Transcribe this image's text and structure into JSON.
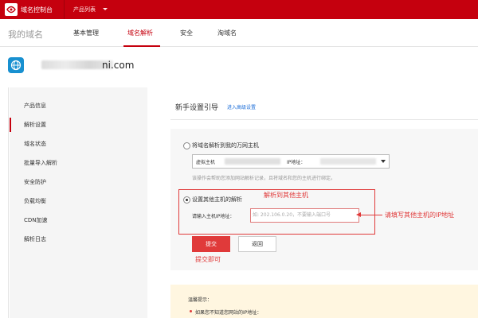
{
  "topbar": {
    "brand": "域名控制台",
    "product_list": "产品列表"
  },
  "nav": {
    "title": "我的域名",
    "tabs": [
      {
        "label": "基本管理",
        "active": false
      },
      {
        "label": "域名解析",
        "active": true
      },
      {
        "label": "安全",
        "active": false
      },
      {
        "label": "淘域名",
        "active": false
      }
    ]
  },
  "domain": {
    "name_visible_part": "ni.com"
  },
  "sidebar": {
    "items": [
      {
        "label": "产品信息",
        "active": false
      },
      {
        "label": "解析设置",
        "active": true
      },
      {
        "label": "域名状态",
        "active": false
      },
      {
        "label": "批量导入解析",
        "active": false
      },
      {
        "label": "安全防护",
        "active": false
      },
      {
        "label": "负载均衡",
        "active": false
      },
      {
        "label": "CDN加速",
        "active": false
      },
      {
        "label": "解析日志",
        "active": false
      }
    ]
  },
  "main": {
    "section_title": "新手设置引导",
    "advanced_link": "进入高级设置",
    "option1": {
      "label": "将域名解析到我的万网主机",
      "selected": false,
      "select_text_prefix": "虚拟主机",
      "select_text_ip": "IP地址：",
      "help_text": "该操作会帮助您添加网站解析记录，且将域名和您的主机进行绑定。"
    },
    "option2": {
      "label": "设置其他主机的解析",
      "selected": true,
      "ip_label": "请输入主机IP地址：",
      "ip_placeholder": "如: 202.106.0.20，不要输入端口号"
    },
    "buttons": {
      "submit": "提交",
      "back": "返回"
    }
  },
  "annotations": {
    "resolve_other": "解析到其他主机",
    "fill_ip": "请填写其他主机的IP地址",
    "submit_done": "提交即可"
  },
  "tips": {
    "title": "温馨提示：",
    "item1": "如果您不知道您网站的IP地址："
  },
  "colors": {
    "brand_red": "#c5000e",
    "annotation_red": "#e03a3a",
    "link_blue": "#1e6fd9"
  }
}
